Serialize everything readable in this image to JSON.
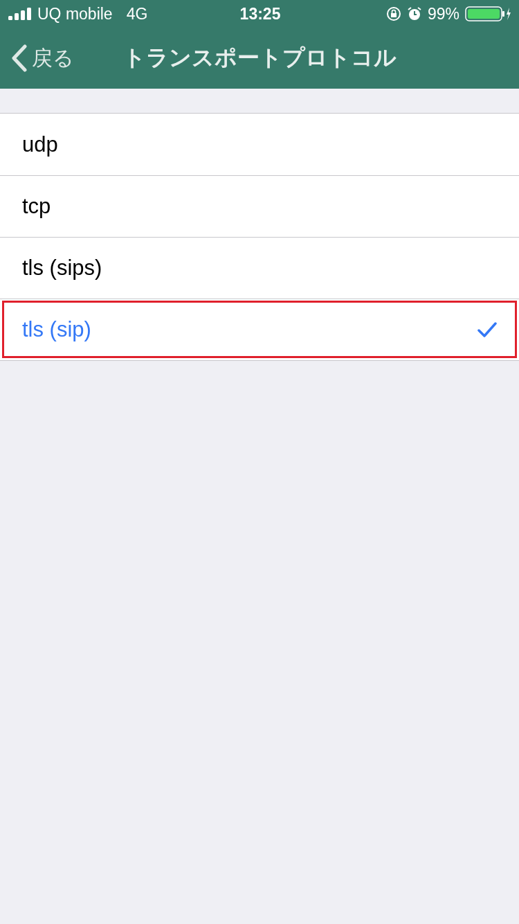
{
  "status_bar": {
    "carrier": "UQ mobile",
    "network": "4G",
    "time": "13:25",
    "battery": "99%"
  },
  "nav": {
    "back": "戻る",
    "title": "トランスポートプロトコル"
  },
  "options": [
    {
      "label": "udp",
      "selected": false,
      "highlighted": false
    },
    {
      "label": "tcp",
      "selected": false,
      "highlighted": false
    },
    {
      "label": "tls (sips)",
      "selected": false,
      "highlighted": false
    },
    {
      "label": "tls (sip)",
      "selected": true,
      "highlighted": true
    }
  ]
}
